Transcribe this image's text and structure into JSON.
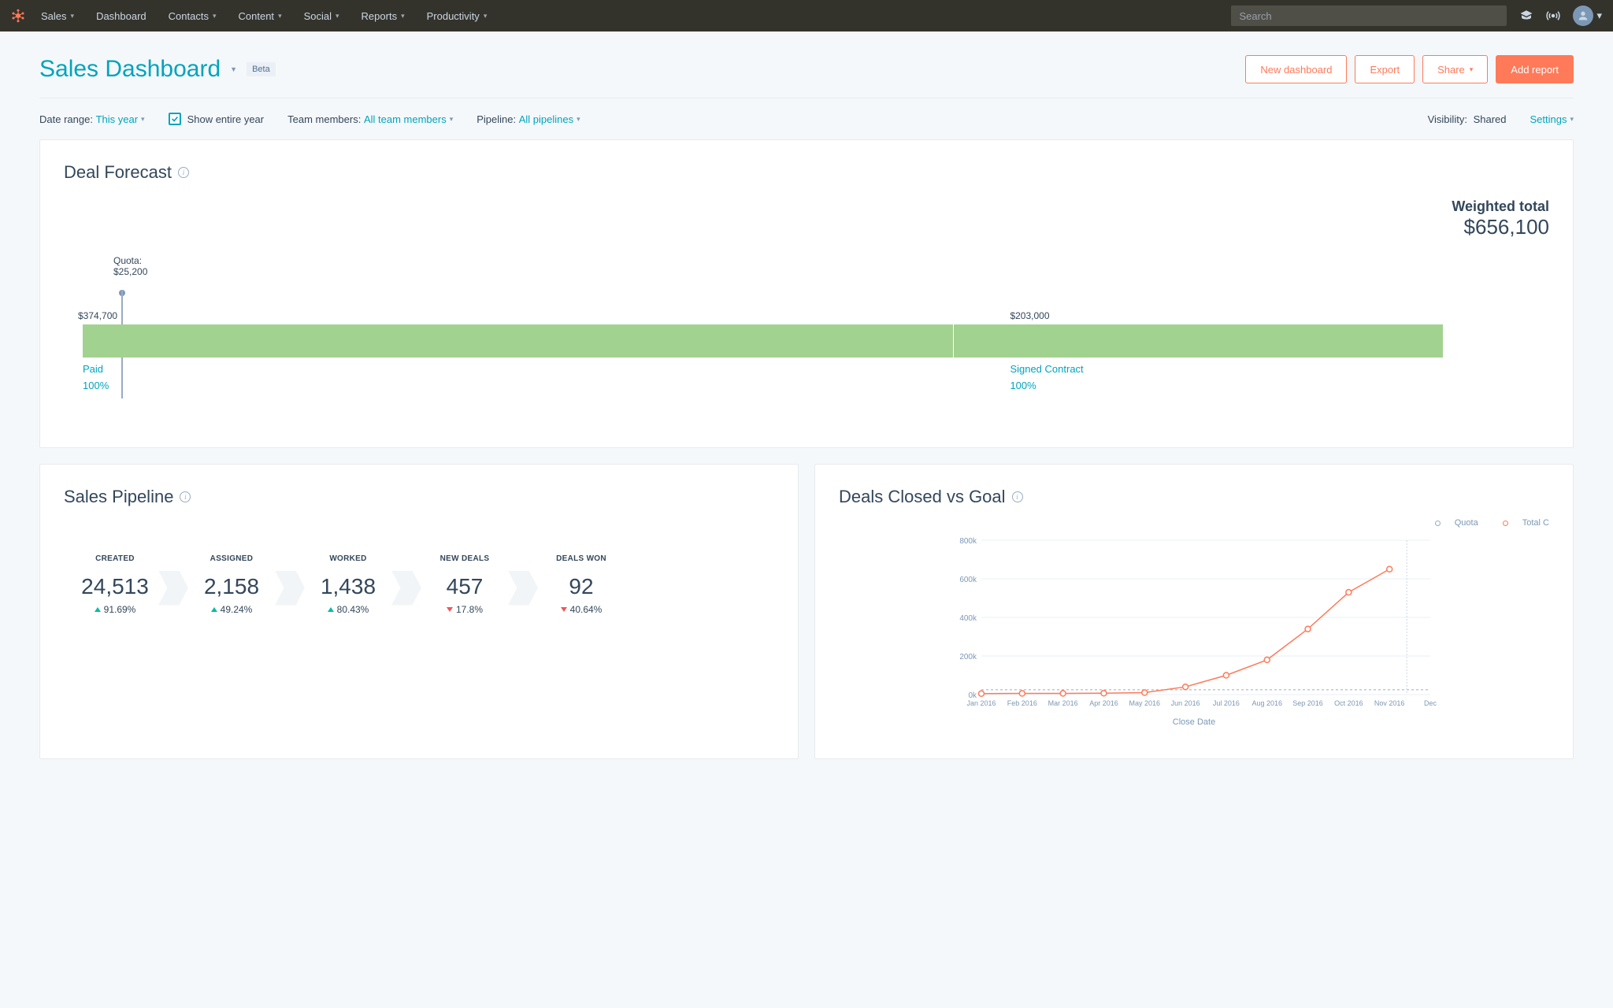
{
  "nav": {
    "brand": "Sales",
    "items": [
      "Dashboard",
      "Contacts",
      "Content",
      "Social",
      "Reports",
      "Productivity"
    ],
    "search_placeholder": "Search"
  },
  "header": {
    "title": "Sales Dashboard",
    "beta": "Beta",
    "new_dashboard": "New dashboard",
    "export": "Export",
    "share": "Share",
    "add_report": "Add report"
  },
  "filters": {
    "date_label": "Date range:",
    "date_value": "This year",
    "show_entire": "Show entire year",
    "team_label": "Team members:",
    "team_value": "All team members",
    "pipeline_label": "Pipeline:",
    "pipeline_value": "All pipelines",
    "visibility_label": "Visibility:",
    "visibility_value": "Shared",
    "settings": "Settings"
  },
  "forecast": {
    "title": "Deal Forecast",
    "weighted_label": "Weighted total",
    "weighted_value": "$656,100",
    "quota_label": "Quota:",
    "quota_value": "$25,200",
    "current_label": "$374,700",
    "seg2_value": "$203,000",
    "paid_label": "Paid",
    "paid_pct": "100%",
    "signed_label": "Signed Contract",
    "signed_pct": "100%"
  },
  "pipeline": {
    "title": "Sales Pipeline",
    "stages": [
      {
        "label": "CREATED",
        "value": "24,513",
        "pct": "91.69%",
        "dir": "up"
      },
      {
        "label": "ASSIGNED",
        "value": "2,158",
        "pct": "49.24%",
        "dir": "up"
      },
      {
        "label": "WORKED",
        "value": "1,438",
        "pct": "80.43%",
        "dir": "up"
      },
      {
        "label": "NEW DEALS",
        "value": "457",
        "pct": "17.8%",
        "dir": "down"
      },
      {
        "label": "DEALS WON",
        "value": "92",
        "pct": "40.64%",
        "dir": "down"
      }
    ]
  },
  "closedvgoal": {
    "title": "Deals Closed vs Goal",
    "legend_quota": "Quota",
    "legend_total": "Total C",
    "xlabel": "Close Date"
  },
  "chart_data": {
    "type": "line",
    "title": "Deals Closed vs Goal",
    "xlabel": "Close Date",
    "ylabel": "",
    "ylim": [
      0,
      800000
    ],
    "y_ticks": [
      "0k",
      "200k",
      "400k",
      "600k",
      "800k"
    ],
    "categories": [
      "Jan 2016",
      "Feb 2016",
      "Mar 2016",
      "Apr 2016",
      "May 2016",
      "Jun 2016",
      "Jul 2016",
      "Aug 2016",
      "Sep 2016",
      "Oct 2016",
      "Nov 2016",
      "Dec"
    ],
    "series": [
      {
        "name": "Total C",
        "color": "#ff7a59",
        "values": [
          5000,
          6000,
          6000,
          7000,
          10000,
          40000,
          100000,
          180000,
          340000,
          530000,
          650000,
          null
        ]
      },
      {
        "name": "Quota",
        "color": "#99acc2",
        "style": "dashed",
        "values": [
          25200,
          25200,
          25200,
          25200,
          25200,
          25200,
          25200,
          25200,
          25200,
          25200,
          25200,
          25200
        ]
      }
    ]
  }
}
